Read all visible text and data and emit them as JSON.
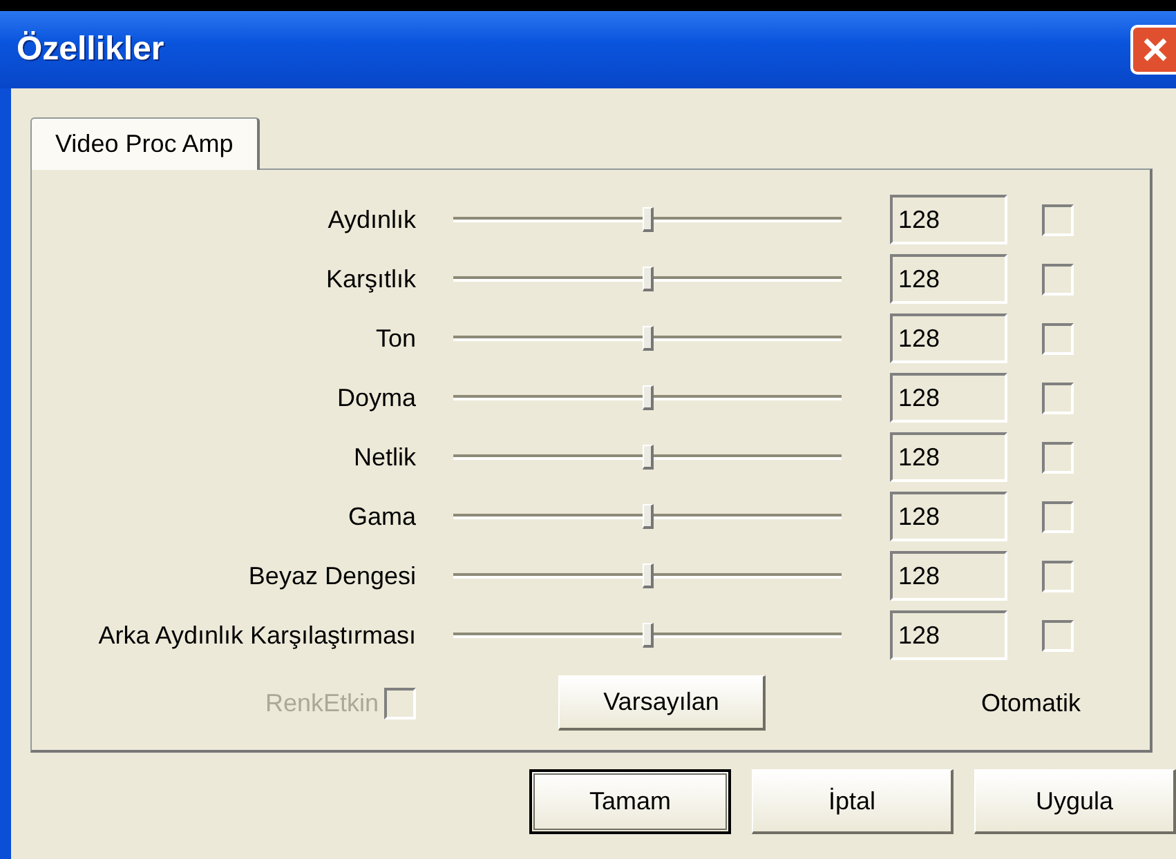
{
  "window": {
    "title": "Özellikler"
  },
  "tabs": [
    {
      "label": "Video Proc Amp",
      "selected": true
    }
  ],
  "controls": [
    {
      "label": "Aydınlık",
      "level": 0.5,
      "value": "128",
      "auto": false
    },
    {
      "label": "Karşıtlık",
      "level": 0.5,
      "value": "128",
      "auto": false
    },
    {
      "label": "Ton",
      "level": 0.5,
      "value": "128",
      "auto": false
    },
    {
      "label": "Doyma",
      "level": 0.5,
      "value": "128",
      "auto": false
    },
    {
      "label": "Netlik",
      "level": 0.5,
      "value": "128",
      "auto": false
    },
    {
      "label": "Gama",
      "level": 0.5,
      "value": "128",
      "auto": false
    },
    {
      "label": "Beyaz Dengesi",
      "level": 0.5,
      "value": "128",
      "auto": false
    },
    {
      "label": "Arka Aydınlık Karşılaştırması",
      "level": 0.5,
      "value": "128",
      "auto": false
    }
  ],
  "color_enable": {
    "label": "RenkEtkin",
    "checked": false,
    "disabled": true
  },
  "defaults_button": "Varsayılan",
  "auto_label": "Otomatik",
  "buttons": [
    {
      "label": "Tamam",
      "default": true
    },
    {
      "label": "İptal",
      "default": false
    },
    {
      "label": "Uygula",
      "default": false
    }
  ]
}
